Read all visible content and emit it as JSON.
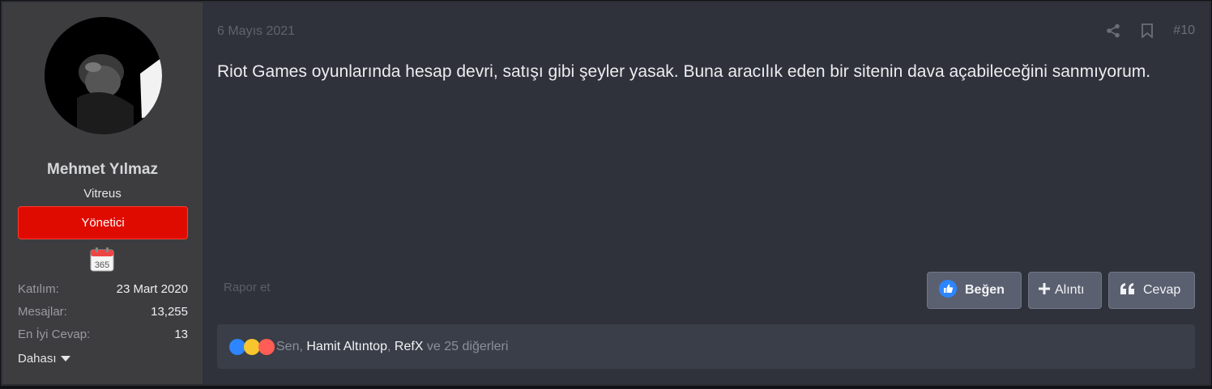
{
  "user": {
    "name": "Mehmet Yılmaz",
    "title": "Vitreus",
    "role": "Yönetici",
    "trophy_text": "365",
    "stats": [
      {
        "label": "Katılım:",
        "value": "23 Mart 2020"
      },
      {
        "label": "Mesajlar:",
        "value": "13,255"
      },
      {
        "label": "En İyi Cevap:",
        "value": "13"
      }
    ],
    "more_label": "Dahası"
  },
  "post": {
    "date": "6 Mayıs 2021",
    "number": "#10",
    "body": "Riot Games oyunlarında hesap devri, satışı gibi şeyler yasak. Buna aracılık eden bir sitenin dava açabileceğini sanmıyorum.",
    "report_label": "Rapor et"
  },
  "buttons": {
    "like": "Beğen",
    "quote": "Alıntı",
    "reply": "Cevap"
  },
  "reactions": {
    "icons": [
      "like-icon",
      "laugh-icon",
      "love-icon"
    ],
    "you": "Sen,",
    "user1": "Hamit Altıntop",
    "sep": ",",
    "user2": "RefX",
    "others": "ve 25 diğerleri"
  },
  "colors": {
    "role_badge": "#e00b00",
    "like_reaction": "#2d86ff",
    "laugh_reaction": "#f7c52d",
    "love_reaction": "#ff5d55"
  }
}
